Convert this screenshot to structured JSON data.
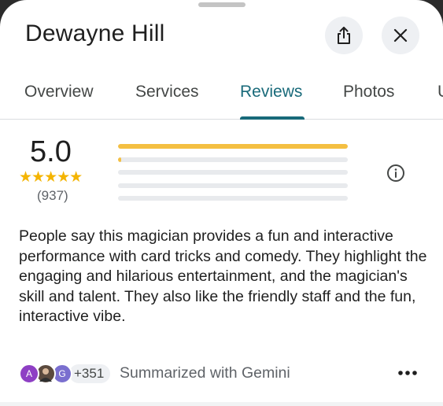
{
  "header": {
    "title": "Dewayne Hill",
    "share_icon": "share-icon",
    "close_icon": "close-icon"
  },
  "tabs": [
    {
      "label": "Overview",
      "active": false
    },
    {
      "label": "Services",
      "active": false
    },
    {
      "label": "Reviews",
      "active": true
    },
    {
      "label": "Photos",
      "active": false
    },
    {
      "label": "U",
      "active": false
    }
  ],
  "rating": {
    "value": "5.0",
    "stars": "★★★★★",
    "count": "(937)",
    "distribution": [
      {
        "stars": 5,
        "fill": 1.0
      },
      {
        "stars": 4,
        "fill": 0.01
      },
      {
        "stars": 3,
        "fill": 0
      },
      {
        "stars": 2,
        "fill": 0
      },
      {
        "stars": 1,
        "fill": 0
      }
    ],
    "info_icon": "info-icon"
  },
  "summary": {
    "text": "People say this magician provides a fun and interactive performance with card tricks and comedy. They highlight the engaging and hilarious entertainment, and the magician's skill and talent. They also like the friendly staff and the fun, interactive vibe."
  },
  "footer": {
    "avatars": [
      {
        "initial": "A",
        "color": "#8e3fc4"
      },
      {
        "initial": "",
        "color": "#5b4a3e"
      },
      {
        "initial": "G",
        "color": "#7a6fcf"
      }
    ],
    "more_count": "+351",
    "summarized_label": "Summarized with Gemini",
    "more_icon": "more-horizontal-icon"
  },
  "colors": {
    "accent": "#196a7a",
    "star": "#f4b400",
    "bar_fill": "#f4bf42"
  }
}
